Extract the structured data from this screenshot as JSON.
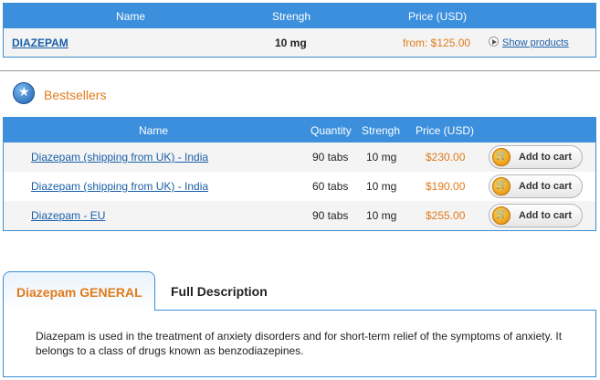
{
  "product_table": {
    "headers": {
      "name": "Name",
      "strength": "Strengh",
      "price": "Price (USD)"
    },
    "row": {
      "name": "DIAZEPAM",
      "strength": "10 mg",
      "price": "from: $125.00",
      "show_label": "Show products"
    }
  },
  "bestsellers": {
    "title": "Bestsellers",
    "headers": {
      "name": "Name",
      "quantity": "Quantity",
      "strength": "Strengh",
      "price": "Price (USD)"
    },
    "rows": [
      {
        "name": "Diazepam (shipping from UK) - India",
        "quantity": "90 tabs",
        "strength": "10 mg",
        "price": "$230.00",
        "button": "Add to cart"
      },
      {
        "name": "Diazepam (shipping from UK) - India",
        "quantity": "60 tabs",
        "strength": "10 mg",
        "price": "$190.00",
        "button": "Add to cart"
      },
      {
        "name": "Diazepam - EU",
        "quantity": "90 tabs",
        "strength": "10 mg",
        "price": "$255.00",
        "button": "Add to cart"
      }
    ]
  },
  "tabs": {
    "active": "Diazepam GENERAL",
    "inactive": "Full Description",
    "content": "Diazepam is used in the treatment of anxiety disorders and for short-term relief of the symptoms of anxiety. It belongs to a class of drugs known as benzodiazepines."
  },
  "colors": {
    "accent_blue": "#3b8fdc",
    "price_orange": "#e07b1a",
    "link_blue": "#1a5fa8"
  },
  "icons": [
    "play-icon",
    "star-icon",
    "cart-icon"
  ]
}
